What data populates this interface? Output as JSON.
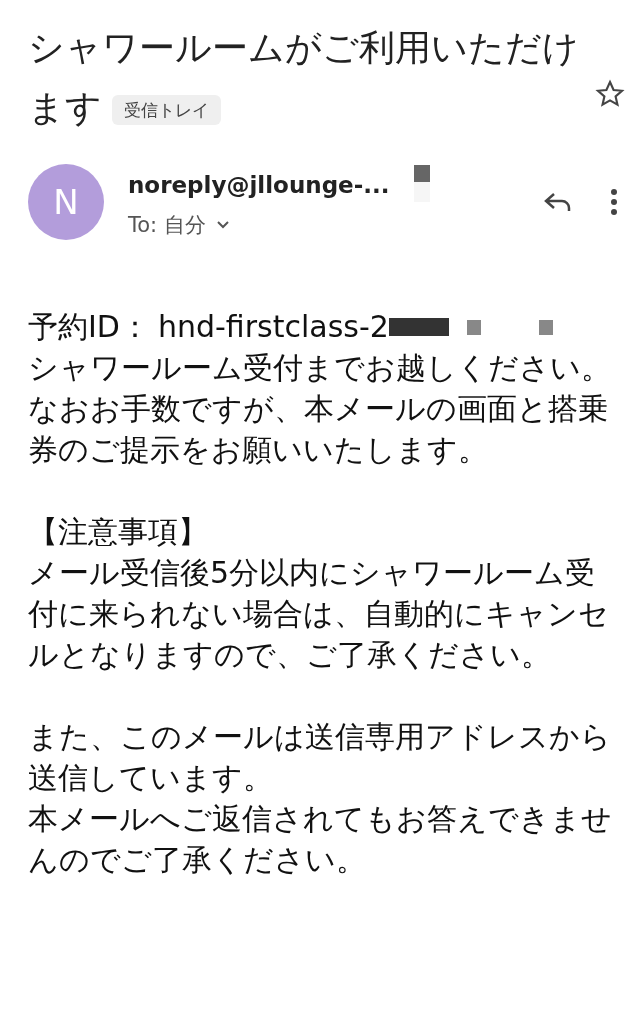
{
  "subject": {
    "title": "シャワールームがご利用いただけます",
    "label": "受信トレイ",
    "starred": false
  },
  "sender": {
    "initial": "N",
    "name": "noreply@jllounge-...",
    "to": "To: 自分"
  },
  "body": {
    "id_label": "予約ID：",
    "id_value": "hnd-firstclass-2",
    "blocks": [
      [
        "シャワールーム受付までお越しください。",
        "なおお手数ですが、本メールの画面と搭乗券のご提示をお願いいたします。"
      ],
      [
        "【注意事項】",
        "メール受信後5分以内にシャワールーム受付に来られない場合は、自動的にキャンセルとなりますので、ご了承ください。"
      ],
      [
        "また、このメールは送信専用アドレスから送信しています。",
        "本メールへご返信されてもお答えできませんのでご了承ください。"
      ]
    ]
  }
}
